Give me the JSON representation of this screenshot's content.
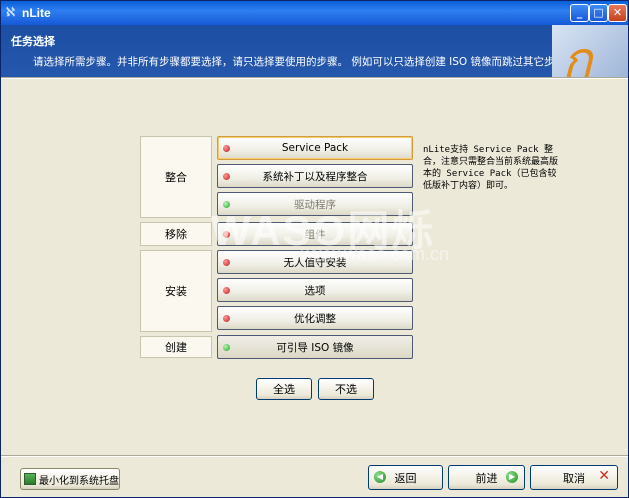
{
  "window": {
    "title": "nLite",
    "app_icon": "nlite-icon"
  },
  "header": {
    "title": "任务选择",
    "subtitle": "请选择所需步骤。并非所有步骤都要选择，请只选择要使用的步骤。 例如可以只选择创建 ISO 镜像而跳过其它步骤。"
  },
  "categories": {
    "integrate": "整合",
    "remove": "移除",
    "setup": "安装",
    "create": "创建"
  },
  "tasks": {
    "service_pack": "Service Pack",
    "hotfixes": "系统补丁以及程序整合",
    "drivers": "驱动程序",
    "components": "组件",
    "unattended": "无人值守安装",
    "options": "选项",
    "tweaks": "优化调整",
    "bootable_iso": "可引导 ISO 镜像"
  },
  "description": "nLite支持 Service Pack 整合，注意只需整合当前系统最高版本的 Service Pack（已包含较低版补丁内容）即可。",
  "buttons": {
    "select_all": "全选",
    "select_none": "不选",
    "minimize_tray": "最小化到系统托盘",
    "back": "返回",
    "next": "前进",
    "cancel": "取消"
  },
  "watermark": {
    "brand": "WASO网烁",
    "url": "www.waso.com.cn"
  },
  "colors": {
    "header_bg": "#2558ad",
    "window_bg": "#ece9d8",
    "titlebar": "#1659d6"
  }
}
